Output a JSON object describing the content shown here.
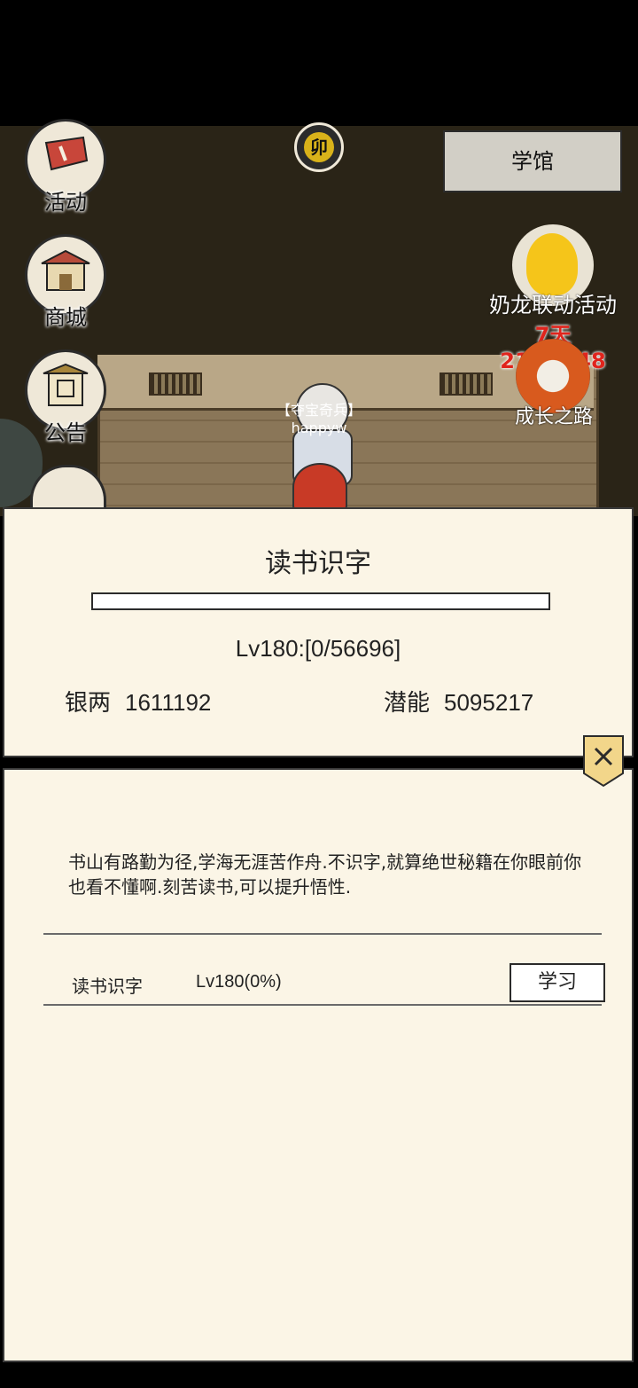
{
  "hud": {
    "activity_label": "活动",
    "shop_label": "商城",
    "notice_label": "公告",
    "time_glyph": "卯",
    "location_button": "学馆",
    "event_label": "奶龙联动活动",
    "event_timer": "7天21:57:48",
    "growth_label": "成长之路"
  },
  "player": {
    "title": "【夺宝奇兵】",
    "name": "happyw"
  },
  "skill_panel": {
    "title": "读书识字",
    "progress_fraction": 0,
    "level_text": "Lv180:[0/56696]",
    "silver_label": "银两",
    "silver_value": "1611192",
    "potential_label": "潜能",
    "potential_value": "5095217"
  },
  "detail_panel": {
    "description": "书山有路勤为径,学海无涯苦作舟.不识字,就算绝世秘籍在你眼前你也看不懂啊.刻苦读书,可以提升悟性.",
    "row_name": "读书识字",
    "row_level": "Lv180(0%)",
    "learn_button": "学习"
  },
  "colors": {
    "panel_bg": "#fbf5e6",
    "timer_red": "#e0241c",
    "time_gold": "#d9b21a"
  },
  "icons": [
    "activity-icon",
    "shop-icon",
    "notice-icon",
    "time-icon",
    "event-icon",
    "growth-icon",
    "close-icon"
  ]
}
